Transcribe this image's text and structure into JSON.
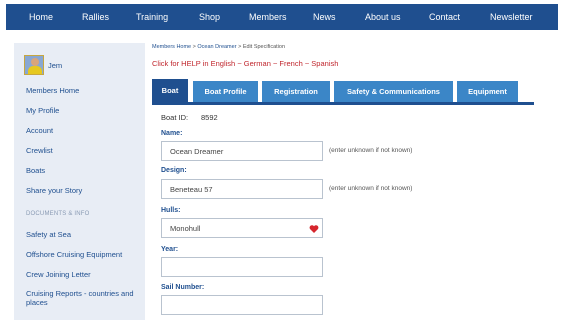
{
  "topnav": {
    "items": [
      "Home",
      "Rallies",
      "Training",
      "Shop",
      "Members",
      "News",
      "About us",
      "Contact",
      "Newsletter"
    ],
    "bg_color": "#1f4f8f"
  },
  "sidebar": {
    "user_name": "Jem",
    "links": [
      "Members Home",
      "My Profile",
      "Account",
      "Crewlist",
      "Boats",
      "Share your Story"
    ],
    "section_title": "DOCUMENTS & INFO",
    "doc_links": [
      "Safety at Sea",
      "Offshore Cruising Equipment",
      "Crew Joining Letter",
      "Cruising Reports - countries and places"
    ]
  },
  "breadcrumb": {
    "members_home": "Members Home",
    "sep1": ">",
    "boat": "Ocean Dreamer",
    "sep2": ">",
    "current": "Edit Specification"
  },
  "help_text": "Click for HELP in English ~ German ~ French ~ Spanish",
  "tabs": [
    "Boat",
    "Boat Profile",
    "Registration",
    "Safety & Communications",
    "Equipment"
  ],
  "form": {
    "boat_id_label": "Boat ID:",
    "boat_id_value": "8592",
    "name_label": "Name:",
    "name_value": "Ocean Dreamer",
    "name_hint": "(enter unknown if not known)",
    "design_label": "Design:",
    "design_value": "Beneteau 57",
    "design_hint": "(enter unknown if not known)",
    "hulls_label": "Hulls:",
    "hulls_value": "Monohull",
    "year_label": "Year:",
    "year_value": "",
    "sail_label": "Sail Number:",
    "sail_value": ""
  },
  "colors": {
    "accent": "#1f4f8f",
    "tab": "#3b86c7",
    "help": "#c0262d",
    "sidebar": "#e8edf5"
  }
}
